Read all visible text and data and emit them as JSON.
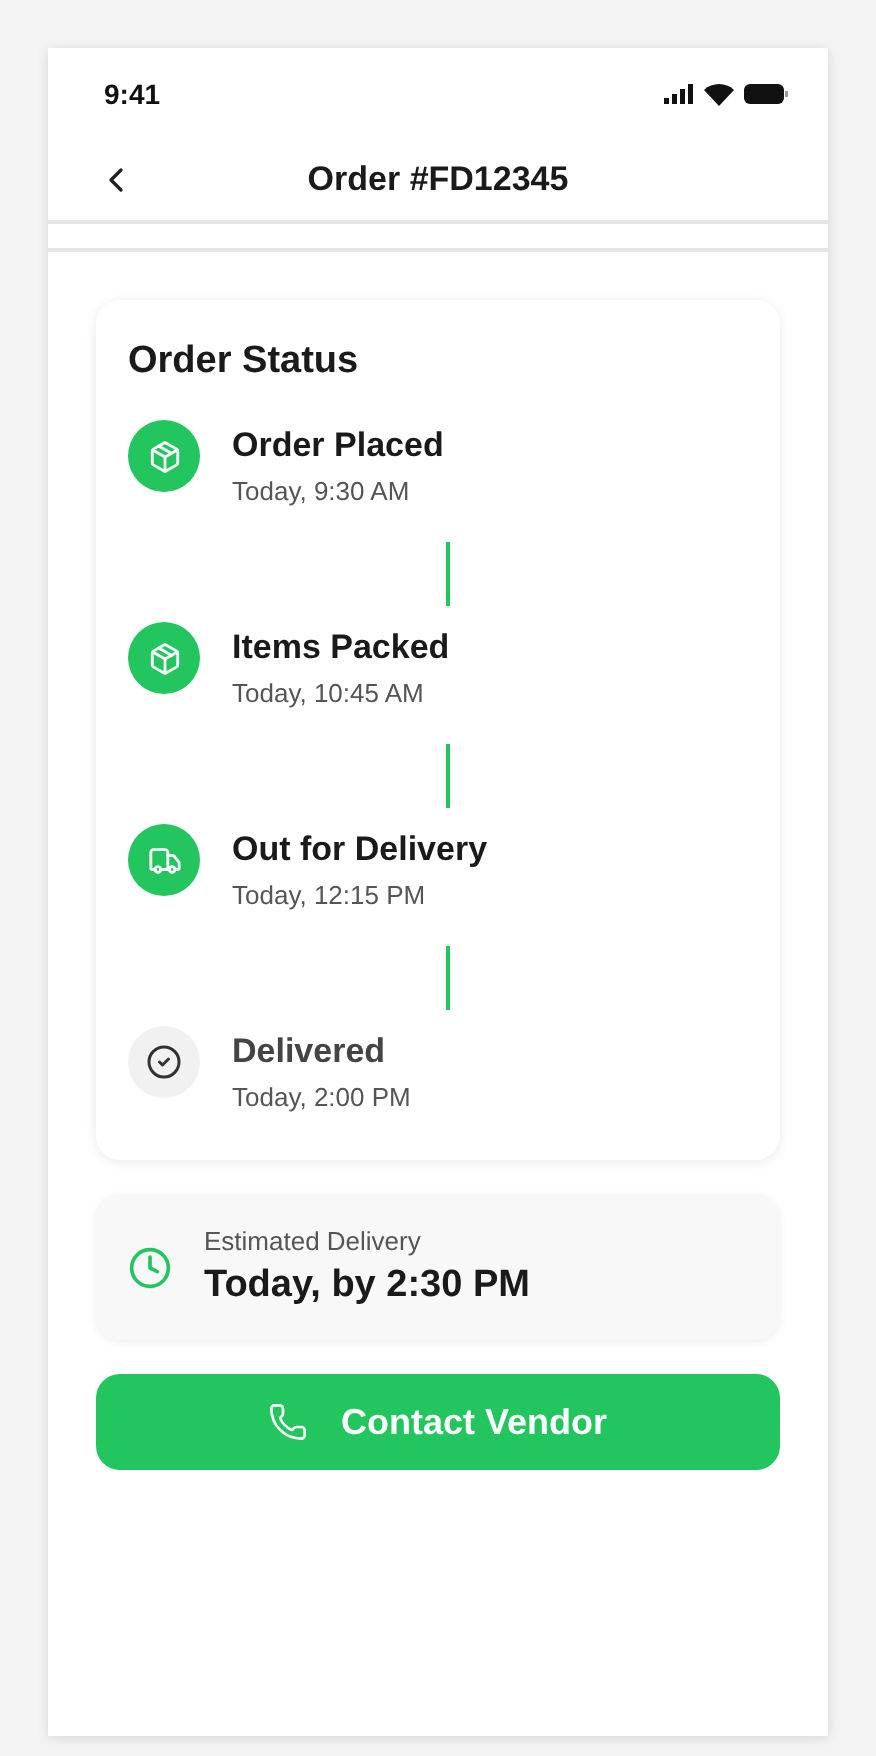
{
  "status_bar": {
    "time": "9:41"
  },
  "header": {
    "title": "Order #FD12345"
  },
  "order_status": {
    "title": "Order Status",
    "steps": [
      {
        "kind": "package",
        "title": "Order Placed",
        "time": "Today, 9:30 AM",
        "done": true
      },
      {
        "kind": "package",
        "title": "Items Packed",
        "time": "Today, 10:45 AM",
        "done": true
      },
      {
        "kind": "truck",
        "title": "Out for Delivery",
        "time": "Today, 12:15 PM",
        "done": true
      },
      {
        "kind": "check",
        "title": "Delivered",
        "time": "Today, 2:00 PM",
        "done": false
      }
    ]
  },
  "estimate": {
    "label": "Estimated Delivery",
    "value": "Today, by 2:30 PM"
  },
  "contact_button": {
    "label": "Contact Vendor"
  }
}
